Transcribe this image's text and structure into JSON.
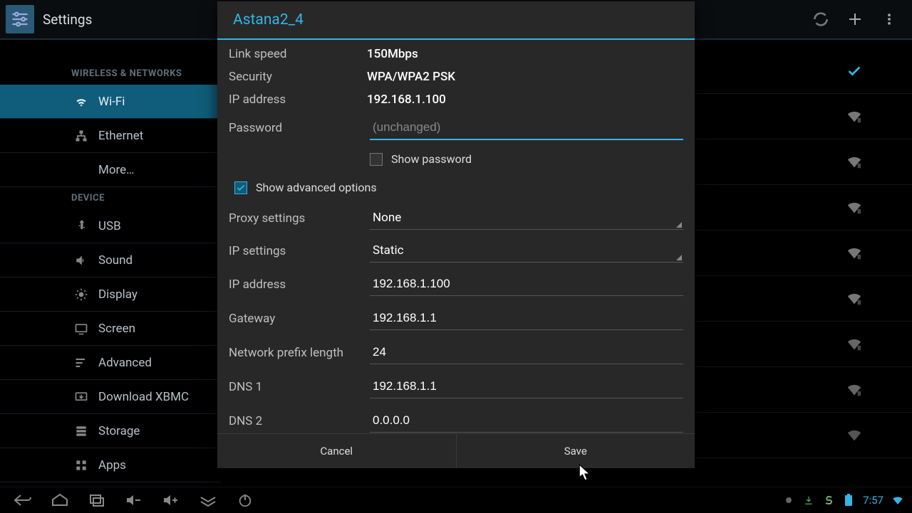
{
  "actionbar": {
    "title": "Settings"
  },
  "sidebar": {
    "section1": "WIRELESS & NETWORKS",
    "items1": [
      {
        "label": "Wi-Fi"
      },
      {
        "label": "Ethernet"
      },
      {
        "label": "More…"
      }
    ],
    "section2": "DEVICE",
    "items2": [
      {
        "label": "USB"
      },
      {
        "label": "Sound"
      },
      {
        "label": "Display"
      },
      {
        "label": "Screen"
      },
      {
        "label": "Advanced"
      },
      {
        "label": "Download XBMC"
      },
      {
        "label": "Storage"
      },
      {
        "label": "Apps"
      }
    ]
  },
  "dialog": {
    "title": "Astana2_4",
    "link_speed_label": "Link speed",
    "link_speed_value": "150Mbps",
    "security_label": "Security",
    "security_value": "WPA/WPA2 PSK",
    "ip_info_label": "IP address",
    "ip_info_value": "192.168.1.100",
    "password_label": "Password",
    "password_placeholder": "(unchanged)",
    "show_password_label": "Show password",
    "show_advanced_label": "Show advanced options",
    "proxy_label": "Proxy settings",
    "proxy_value": "None",
    "ip_settings_label": "IP settings",
    "ip_settings_value": "Static",
    "ip_address_label": "IP address",
    "ip_address_value": "192.168.1.100",
    "gateway_label": "Gateway",
    "gateway_value": "192.168.1.1",
    "prefix_label": "Network prefix length",
    "prefix_value": "24",
    "dns1_label": "DNS 1",
    "dns1_value": "192.168.1.1",
    "dns2_label": "DNS 2",
    "dns2_value": "0.0.0.0",
    "cancel": "Cancel",
    "save": "Save"
  },
  "sysbar": {
    "clock": "7:57"
  }
}
